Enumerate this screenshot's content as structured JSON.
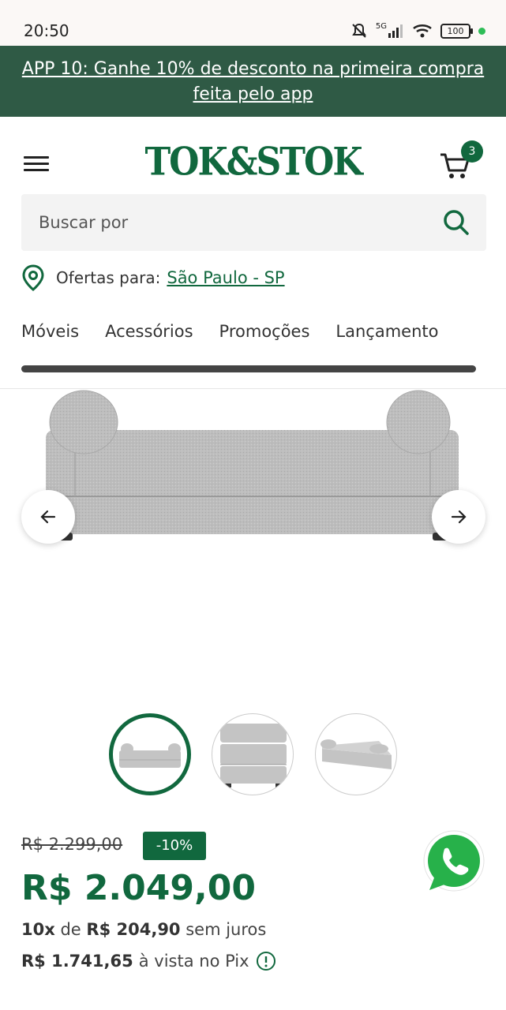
{
  "status": {
    "time": "20:50",
    "battery": "100",
    "network": "5G"
  },
  "promo": {
    "text": "APP 10: Ganhe 10% de desconto na primeira compra feita pelo app"
  },
  "header": {
    "logo": "TOK&STOK",
    "cart_count": "3"
  },
  "search": {
    "placeholder": "Buscar por"
  },
  "location": {
    "label": "Ofertas para:",
    "city": "São Paulo - SP"
  },
  "nav": {
    "items": [
      "Móveis",
      "Acessórios",
      "Promoções",
      "Lançamento"
    ]
  },
  "product": {
    "old_price": "R$ 2.299,00",
    "discount": "-10%",
    "price": "R$ 2.049,00",
    "installments_count": "10x",
    "installments_de": "de",
    "installment_value": "R$ 204,90",
    "installments_suffix": "sem juros",
    "pix_price": "R$ 1.741,65",
    "pix_suffix": "à vista no Pix"
  },
  "colors": {
    "brand": "#11683e",
    "banner": "#2f5a45"
  },
  "icons": [
    "menu-icon",
    "cart-icon",
    "search-icon",
    "location-pin-icon",
    "arrow-left-icon",
    "arrow-right-icon",
    "info-icon",
    "whatsapp-icon"
  ]
}
